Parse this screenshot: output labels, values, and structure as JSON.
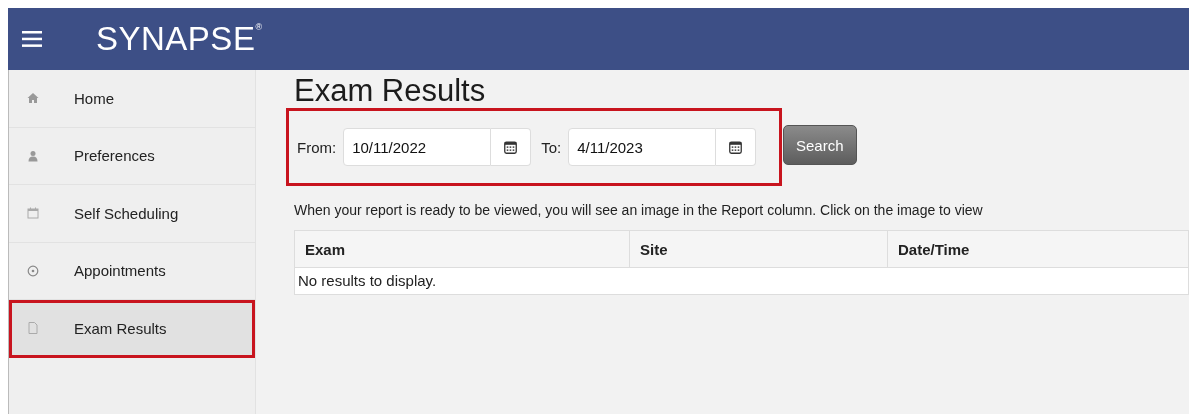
{
  "header": {
    "logo": "SYNAPSE",
    "logo_mark": "®"
  },
  "sidebar": {
    "items": [
      {
        "label": "Home",
        "kind": "home",
        "selected": false,
        "highlighted": false
      },
      {
        "label": "Preferences",
        "kind": "person",
        "selected": false,
        "highlighted": false
      },
      {
        "label": "Self Scheduling",
        "kind": "calendar",
        "selected": false,
        "highlighted": false
      },
      {
        "label": "Appointments",
        "kind": "clock",
        "selected": false,
        "highlighted": false
      },
      {
        "label": "Exam Results",
        "kind": "document",
        "selected": true,
        "highlighted": true
      }
    ]
  },
  "page": {
    "title": "Exam Results",
    "filter": {
      "highlighted": true,
      "from_label": "From:",
      "from_value": "10/11/2022",
      "to_label": "To:",
      "to_value": "4/11/2023",
      "search_button": "Search"
    },
    "note": "When your report is ready to be viewed, you will see an image in the Report column.  Click on the image to view",
    "table": {
      "columns": [
        "Exam",
        "Site",
        "Date/Time"
      ],
      "empty_text": "No results to display."
    }
  }
}
